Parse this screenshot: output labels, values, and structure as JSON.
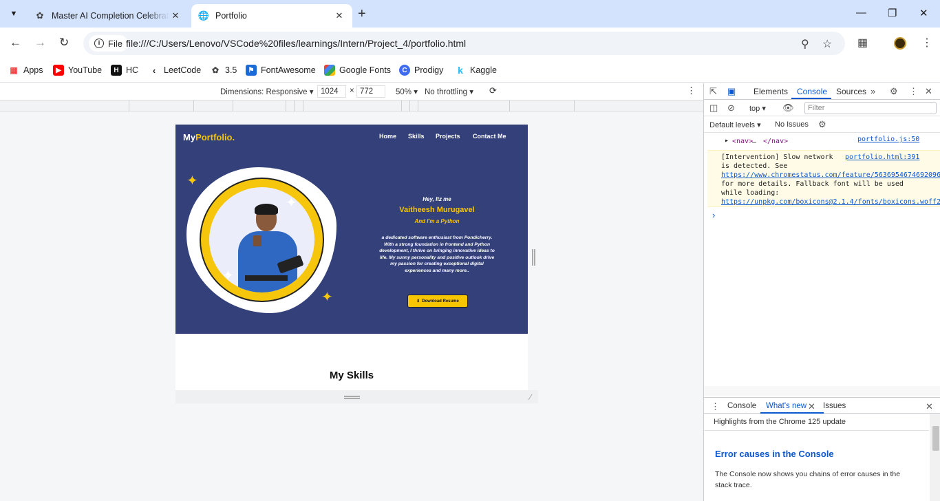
{
  "browser": {
    "tabs": [
      {
        "title": "Master AI Completion Celebrati",
        "active": false
      },
      {
        "title": "Portfolio",
        "active": true
      }
    ],
    "chip_label": "File",
    "url": "file:///C:/Users/Lenovo/VSCode%20files/learnings/Intern/Project_4/portfolio.html"
  },
  "bookmarks": [
    "Apps",
    "YouTube",
    "HC",
    "LeetCode",
    "3.5",
    "FontAwesome",
    "Google Fonts",
    "Prodigy",
    "Kaggle"
  ],
  "device_toolbar": {
    "dimensions_label": "Dimensions: Responsive",
    "width": "1024",
    "times": "×",
    "height": "772",
    "zoom": "50%",
    "throttle": "No throttling"
  },
  "page": {
    "logo_main": "My",
    "logo_accent": "Portfolio.",
    "nav": [
      "Home",
      "Skills",
      "Projects",
      "Contact Me"
    ],
    "greeting": "Hey, Itz me",
    "name": "Vaitheesh Murugavel",
    "role": "And I'm a Python",
    "description": "a dedicated software enthusiast from Pondicherry. With a strong foundation in frontend and Python development, I thrive on bringing innovative ideas to life. My sunny personality and positive outlook drive my passion for creating exceptional digital experiences and many more..",
    "download_label": "Download Resume",
    "skills_title": "My Skills"
  },
  "devtools": {
    "tabs": [
      "Elements",
      "Console",
      "Sources"
    ],
    "context": "top",
    "filter_placeholder": "Filter",
    "levels": "Default levels",
    "issues": "No Issues",
    "log_nav_open": "<nav>",
    "log_nav_dots": "…",
    "log_nav_close": "</nav>",
    "log_nav_source": "portfolio.js:50",
    "warning": {
      "line1": "[Intervention] Slow network",
      "source": "portfolio.html:391",
      "line2": "is detected. See",
      "link1": "https://www.chromestatus.com/feature/5636954674692096",
      "line3": "for more details. Fallback font will be used",
      "line4": "while loading:",
      "link2": "https://unpkg.com/boxicons@2.1.4/fonts/boxicons.woff2"
    },
    "drawer_tabs": [
      "Console",
      "What's new",
      "Issues"
    ],
    "highlights": "Highlights from the Chrome 125 update",
    "whatsnew_title": "Error causes in the Console",
    "whatsnew_text": "The Console now shows you chains of error causes in the stack trace."
  }
}
